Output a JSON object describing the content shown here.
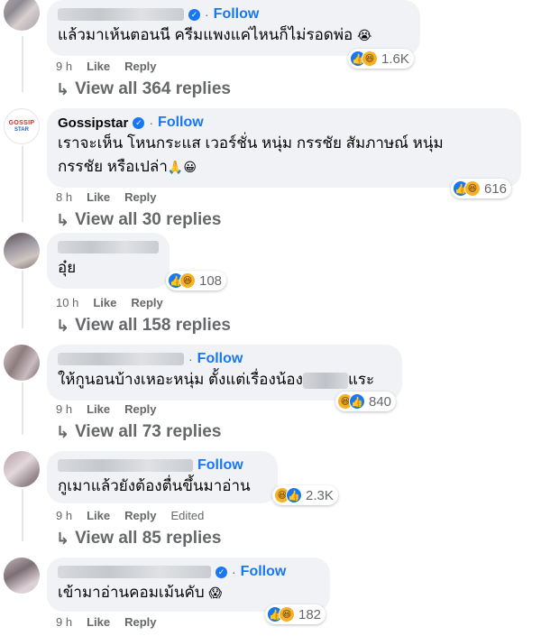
{
  "comments": [
    {
      "name": "",
      "follow": "Follow",
      "text": "แล้วมาเห้นตอนนี ครีมแพงแค่ไหนก็ไม่รอดพ่อ",
      "emoji": "😭",
      "time": "9 h",
      "like": "Like",
      "reply": "Reply",
      "reaction_count": "1.6K",
      "reactions": [
        "like",
        "haha"
      ],
      "replies": "View all 364 replies"
    },
    {
      "name": "Gossipstar",
      "follow": "Follow",
      "text_line1": "เราจะเห็น โหนกระแส เวอร์ชั่น หนุ่ม กรรชัย สัมภาษณ์ หนุ่ม",
      "text_line2": "กรรชัย หรือเปล่า",
      "emoji": "🙏😀",
      "time": "8 h",
      "like": "Like",
      "reply": "Reply",
      "reaction_count": "616",
      "reactions": [
        "like",
        "haha"
      ],
      "replies": "View all 30 replies"
    },
    {
      "name": "",
      "text": "อุ๋ย",
      "time": "10 h",
      "like": "Like",
      "reply": "Reply",
      "reaction_count": "108",
      "reactions": [
        "like",
        "haha"
      ],
      "replies": "View all 158 replies"
    },
    {
      "name": "",
      "follow": "Follow",
      "text_a": "ให้กูนอนบ้างเหอะหนุ่ม ตั้งแต่เรื่องน้อง",
      "text_b": "แระ",
      "time": "9 h",
      "like": "Like",
      "reply": "Reply",
      "reaction_count": "840",
      "reactions": [
        "haha",
        "like"
      ],
      "replies": "View all 73 replies"
    },
    {
      "name": "",
      "follow": "Follow",
      "text": "กูเมาแล้วยังต้องตื่นขึ้นมาอ่าน",
      "time": "9 h",
      "like": "Like",
      "reply": "Reply",
      "edited": "Edited",
      "reaction_count": "2.3K",
      "reactions": [
        "haha",
        "like"
      ],
      "replies": "View all 85 replies"
    },
    {
      "name": "",
      "follow": "Follow",
      "text": "เข้ามาอ่านคอมเม้นคับ",
      "emoji": "😱",
      "time": "9 h",
      "like": "Like",
      "reply": "Reply",
      "reaction_count": "182",
      "reactions": [
        "like",
        "haha"
      ]
    }
  ],
  "logo": {
    "top": "GOSSIP",
    "bottom": "STAR"
  },
  "colors": {
    "accent": "#1877f2",
    "bubble": "#f0f2f5",
    "muted": "#65676b"
  }
}
